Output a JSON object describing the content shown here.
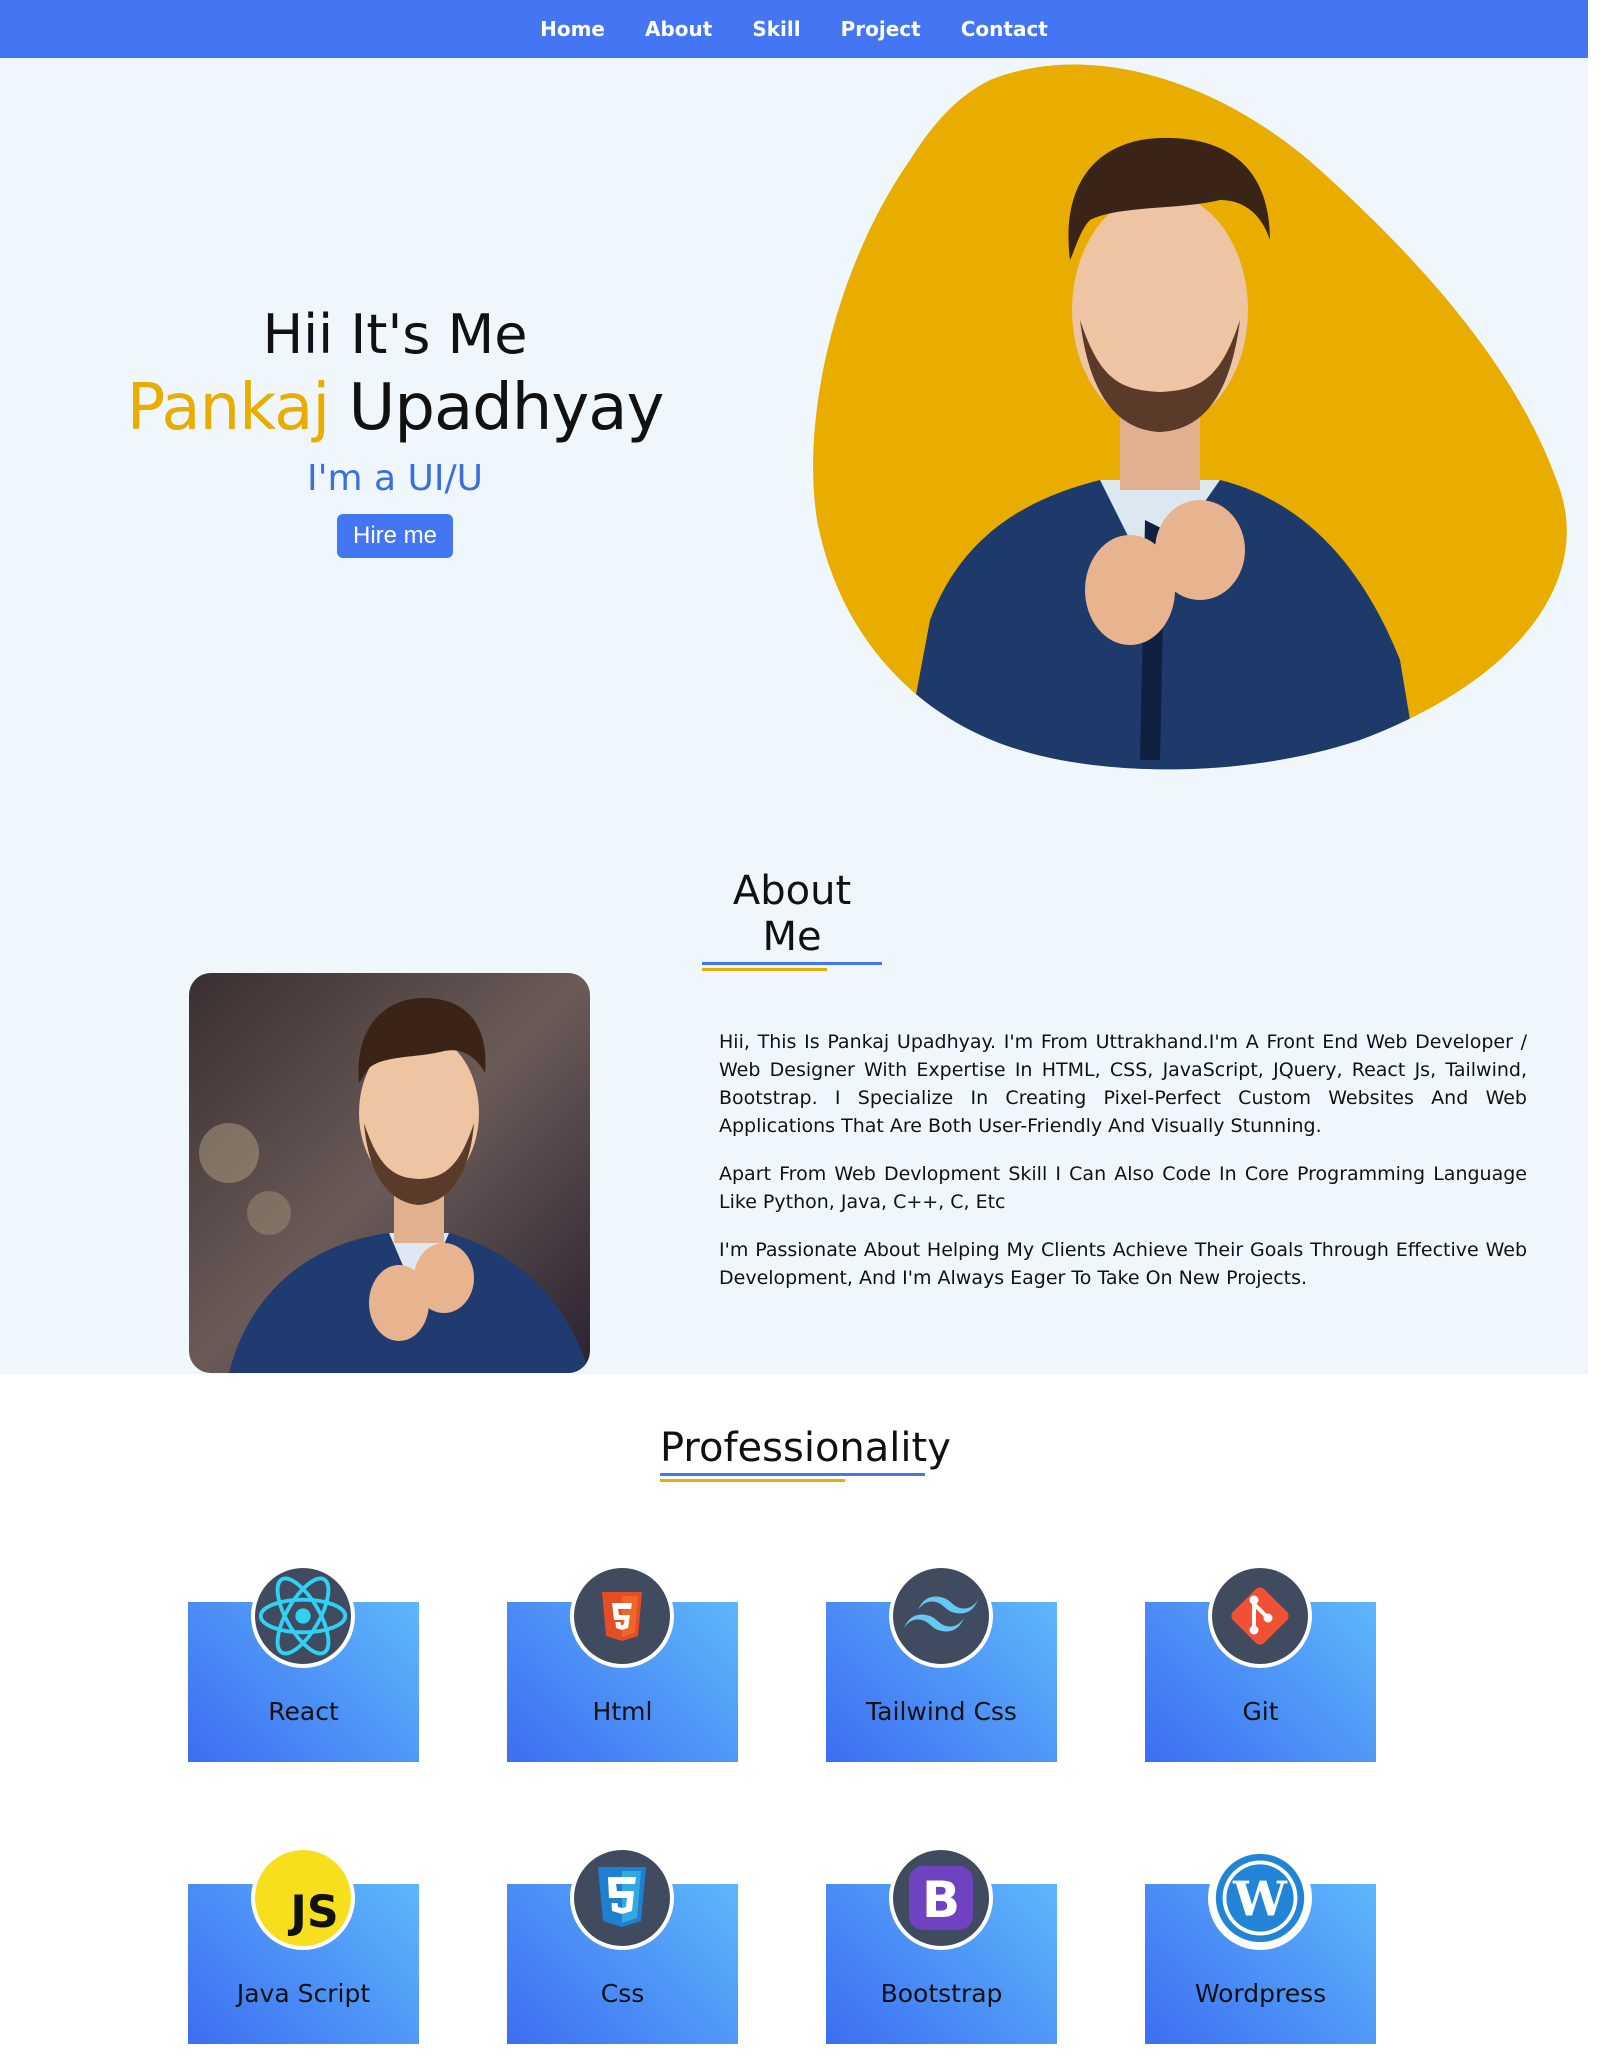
{
  "nav": {
    "items": [
      "Home",
      "About",
      "Skill",
      "Project",
      "Contact"
    ]
  },
  "hero": {
    "greeting": "Hii It's Me",
    "first_name": "Pankaj",
    "last_name": "Upadhyay",
    "role": "I'm a UI/U",
    "hire_button": "Hire me"
  },
  "about": {
    "title": "About Me",
    "paragraphs": [
      "Hii, This Is Pankaj Upadhyay. I'm From Uttrakhand.I'm A Front End Web Developer / Web Designer With Expertise In HTML, CSS, JavaScript, JQuery, React Js, Tailwind, Bootstrap. I Specialize In Creating Pixel-Perfect Custom Websites And Web Applications That Are Both User-Friendly And Visually Stunning.",
      "Apart From Web Devlopment Skill I Can Also Code In Core Programming Language Like Python, Java, C++, C, Etc",
      "I'm Passionate About Helping My Clients Achieve Their Goals Through Effective Web Development, And I'm Always Eager To Take On New Projects."
    ]
  },
  "skills": {
    "title": "Professionality",
    "items": [
      {
        "label": "React",
        "icon": "react-icon"
      },
      {
        "label": "Html",
        "icon": "html5-icon"
      },
      {
        "label": "Tailwind Css",
        "icon": "tailwind-icon"
      },
      {
        "label": "Git",
        "icon": "git-icon"
      },
      {
        "label": "Java Script",
        "icon": "javascript-icon"
      },
      {
        "label": "Css",
        "icon": "css3-icon"
      },
      {
        "label": "Bootstrap",
        "icon": "bootstrap-icon"
      },
      {
        "label": "Wordpress",
        "icon": "wordpress-icon"
      }
    ]
  },
  "colors": {
    "primary": "#4475f2",
    "accent": "#e9ad00",
    "light_bg": "#eff7fd"
  }
}
